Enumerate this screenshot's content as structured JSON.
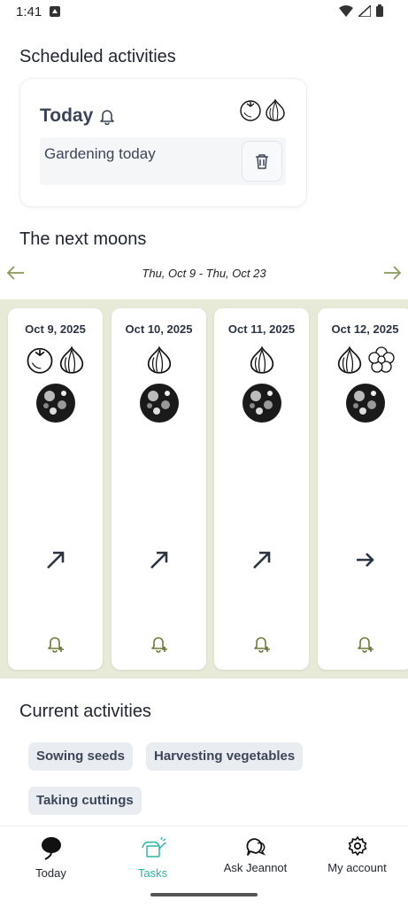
{
  "status_bar": {
    "time": "1:41"
  },
  "scheduled": {
    "title": "Scheduled activities",
    "card": {
      "title": "Today",
      "task": "Gardening today",
      "icons": [
        "tomato-icon",
        "garlic-icon"
      ]
    }
  },
  "moons": {
    "title": "The next moons",
    "range": "Thu, Oct 9 - Thu, Oct 23",
    "days": [
      {
        "date": "Oct 9, 2025",
        "icons": [
          "tomato-icon",
          "garlic-icon"
        ],
        "trend": "up-right"
      },
      {
        "date": "Oct 10, 2025",
        "icons": [
          "garlic-icon"
        ],
        "trend": "up-right"
      },
      {
        "date": "Oct 11, 2025",
        "icons": [
          "garlic-icon"
        ],
        "trend": "up-right"
      },
      {
        "date": "Oct 12, 2025",
        "icons": [
          "garlic-icon",
          "flower-icon"
        ],
        "trend": "right"
      }
    ]
  },
  "current": {
    "title": "Current activities",
    "chips": [
      "Sowing seeds",
      "Harvesting vegetables",
      "Taking cuttings"
    ]
  },
  "bottom_nav": [
    {
      "label": "Today",
      "icon": "leaf-icon",
      "active": false
    },
    {
      "label": "Tasks",
      "icon": "watering-can-icon",
      "active": true
    },
    {
      "label": "Ask Jeannot",
      "icon": "chat-icon",
      "active": false
    },
    {
      "label": "My account",
      "icon": "gear-icon",
      "active": false
    }
  ],
  "colors": {
    "accent": "#2bb3a8",
    "band": "#e8ead8",
    "arrow": "#8a9a5a"
  }
}
